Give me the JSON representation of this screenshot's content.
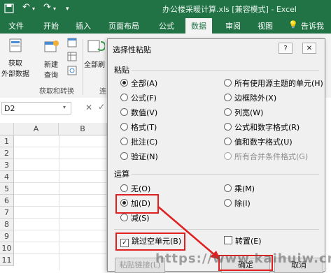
{
  "window": {
    "title": "办公楼采暖计算.xls [兼容模式] - Excel"
  },
  "tabs": [
    "文件",
    "开始",
    "插入",
    "页面布局",
    "公式",
    "数据",
    "审阅",
    "视图"
  ],
  "tell_me": "告诉我",
  "ribbon": {
    "get_data": "获取\n外部数据",
    "new_query": "新建\n查询",
    "all_refresh": "全部刷",
    "group_get_transform": "获取和转换",
    "group_conn": "连"
  },
  "name_box": {
    "value": "D2"
  },
  "columns": [
    "A",
    "B"
  ],
  "rows": [
    "1",
    "2",
    "3",
    "4",
    "5",
    "6",
    "7",
    "8",
    "9",
    "10",
    "11"
  ],
  "dialog": {
    "title": "选择性粘贴",
    "help_label": "?",
    "close_label": "✕",
    "paste_section": "粘贴",
    "paste_options_left": [
      "全部(A)",
      "公式(F)",
      "数值(V)",
      "格式(T)",
      "批注(C)",
      "验证(N)"
    ],
    "paste_options_right": [
      "所有使用源主题的单元(H)",
      "边框除外(X)",
      "列宽(W)",
      "公式和数字格式(R)",
      "值和数字格式(U)",
      "所有合并条件格式(G)"
    ],
    "op_section": "运算",
    "op_options_left": [
      "无(O)",
      "加(D)",
      "减(S)"
    ],
    "op_options_right": [
      "乘(M)",
      "除(I)"
    ],
    "skip_blanks": "跳过空单元(B)",
    "transpose": "转置(E)",
    "paste_link": "粘贴链接(L)",
    "ok": "确定",
    "cancel": "取消"
  },
  "watermark": "https://www.kaihuiw.cn",
  "colors": {
    "excel_green": "#217346",
    "highlight_red": "#e02020"
  }
}
